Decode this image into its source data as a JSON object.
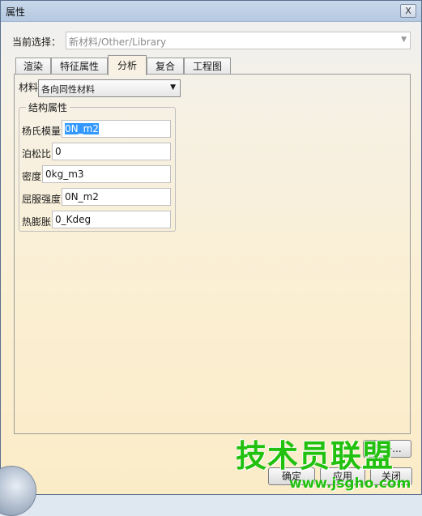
{
  "window": {
    "title": "属性",
    "close_glyph": "X"
  },
  "current_selection": {
    "label": "当前选择：",
    "value": "新材料/Other/Library"
  },
  "tabs": [
    {
      "label": "渲染",
      "active": false
    },
    {
      "label": "特征属性",
      "active": false
    },
    {
      "label": "分析",
      "active": true
    },
    {
      "label": "复合",
      "active": false
    },
    {
      "label": "工程图",
      "active": false
    }
  ],
  "material": {
    "label": "材料",
    "value": "各向同性材料"
  },
  "structural": {
    "title": "结构属性",
    "rows": [
      {
        "label": "杨氏模量",
        "value": "0N_m2"
      },
      {
        "label": "泊松比",
        "value": "0"
      },
      {
        "label": "密度",
        "value": "0kg_m3"
      },
      {
        "label": "屈服强度",
        "value": "0N_m2"
      },
      {
        "label": "热膨胀",
        "value": "0_Kdeg"
      }
    ]
  },
  "buttons": {
    "more": "更多...",
    "ok": "确定",
    "apply": "应用",
    "close": "关闭"
  },
  "icons": {
    "dropdown": "chevron-down-icon",
    "close": "close-icon"
  },
  "watermark": {
    "text": "技术员联盟",
    "url": "www.jsgho.com"
  },
  "colors": {
    "accent_highlight": "#3399ff",
    "watermark_green": "#23c10f"
  }
}
